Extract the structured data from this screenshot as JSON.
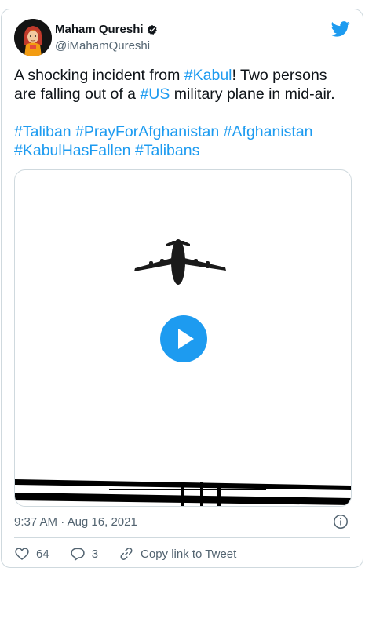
{
  "author": {
    "name": "Maham Qureshi",
    "handle": "@iMahamQureshi"
  },
  "tweet": {
    "line1_pre": "A shocking incident from ",
    "line1_tag": "#Kabul",
    "line1_post": "! Two persons",
    "line2_pre": "are falling out of a ",
    "line2_tag": "#US",
    "line2_post": " military plane in mid-air.",
    "hashtags": [
      "#Taliban",
      "#PrayForAfghanistan",
      "#Afghanistan",
      "#KabulHasFallen",
      "#Talibans"
    ]
  },
  "meta": {
    "time": "9:37 AM",
    "separator": "·",
    "date": "Aug 16, 2021"
  },
  "actions": {
    "likes": "64",
    "replies": "3",
    "copy_link": "Copy link to Tweet"
  },
  "colors": {
    "accent": "#1d9bf0",
    "text": "#0f1419",
    "muted": "#536471",
    "border": "#cfd9de"
  },
  "icons": [
    "twitter-bird-icon",
    "verified-icon",
    "play-icon",
    "info-icon",
    "heart-icon",
    "reply-icon",
    "link-icon"
  ]
}
